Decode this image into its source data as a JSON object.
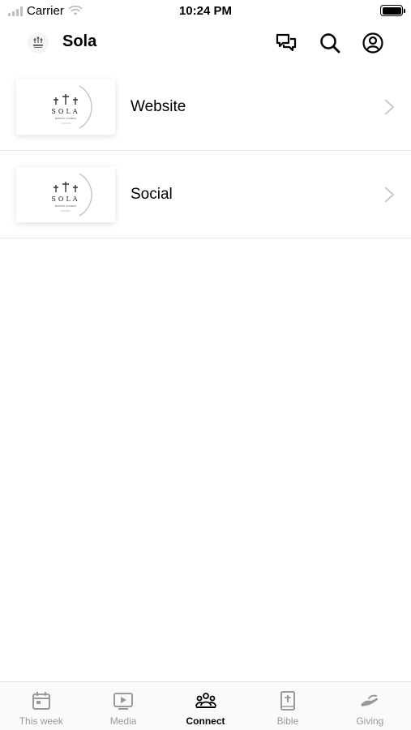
{
  "status_bar": {
    "carrier": "Carrier",
    "time": "10:24 PM"
  },
  "header": {
    "title": "Sola",
    "icons": [
      "chat-icon",
      "search-icon",
      "profile-icon"
    ]
  },
  "logo": {
    "name": "SOLA",
    "subtitle": "BAPTIST CHURCH"
  },
  "list": {
    "items": [
      {
        "label": "Website"
      },
      {
        "label": "Social"
      }
    ]
  },
  "tabs": [
    {
      "label": "This week",
      "icon": "calendar-icon"
    },
    {
      "label": "Media",
      "icon": "play-icon"
    },
    {
      "label": "Connect",
      "icon": "people-icon",
      "active": true
    },
    {
      "label": "Bible",
      "icon": "bible-icon"
    },
    {
      "label": "Giving",
      "icon": "giving-hand-icon"
    }
  ],
  "colors": {
    "active_tab": "#000000",
    "inactive_tab": "#9a9a9a",
    "divider": "#e6e6e6"
  }
}
